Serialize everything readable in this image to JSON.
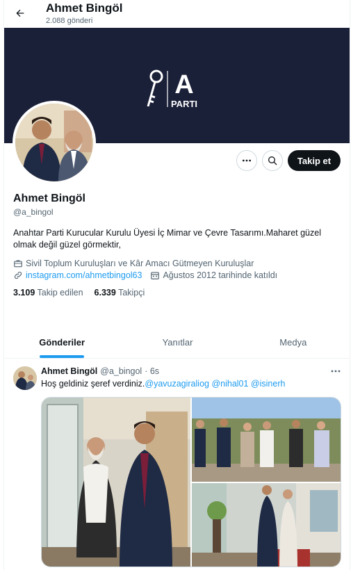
{
  "header": {
    "title": "Ahmet Bingöl",
    "post_count": "2.088 gönderi"
  },
  "banner": {
    "logo_letter": "A",
    "logo_text": "PARTI",
    "background_color": "#1b2039"
  },
  "actions": {
    "more_icon": "more-horizontal-icon",
    "search_icon": "search-icon",
    "follow_label": "Takip et"
  },
  "profile": {
    "name": "Ahmet Bingöl",
    "handle": "@a_bingol",
    "bio": "Anahtar Parti Kurucular Kurulu Üyesi İç Mimar ve Çevre Tasarımı.Maharet güzel olmak değil güzel görmektir,",
    "category": "Sivil Toplum Kuruluşları ve Kâr Amacı Gütmeyen Kuruluşlar",
    "website": "instagram.com/ahmetbingol63",
    "joined": "Ağustos 2012 tarihinde katıldı",
    "following_count": "3.109",
    "following_label": "Takip edilen",
    "followers_count": "6.339",
    "followers_label": "Takipçi"
  },
  "tabs": [
    {
      "label": "Gönderiler",
      "active": true
    },
    {
      "label": "Yanıtlar",
      "active": false
    },
    {
      "label": "Medya",
      "active": false
    }
  ],
  "tweet": {
    "author_name": "Ahmet Bingöl",
    "author_handle": "@a_bingol",
    "time": "· 6s",
    "text": "Hoş geldiniz şeref verdiniz.",
    "mentions": "@yavuzagiraliog @nihal01 @isinerh"
  },
  "colors": {
    "accent": "#1d9bf0",
    "text_primary": "#0f1419",
    "text_secondary": "#536471"
  }
}
